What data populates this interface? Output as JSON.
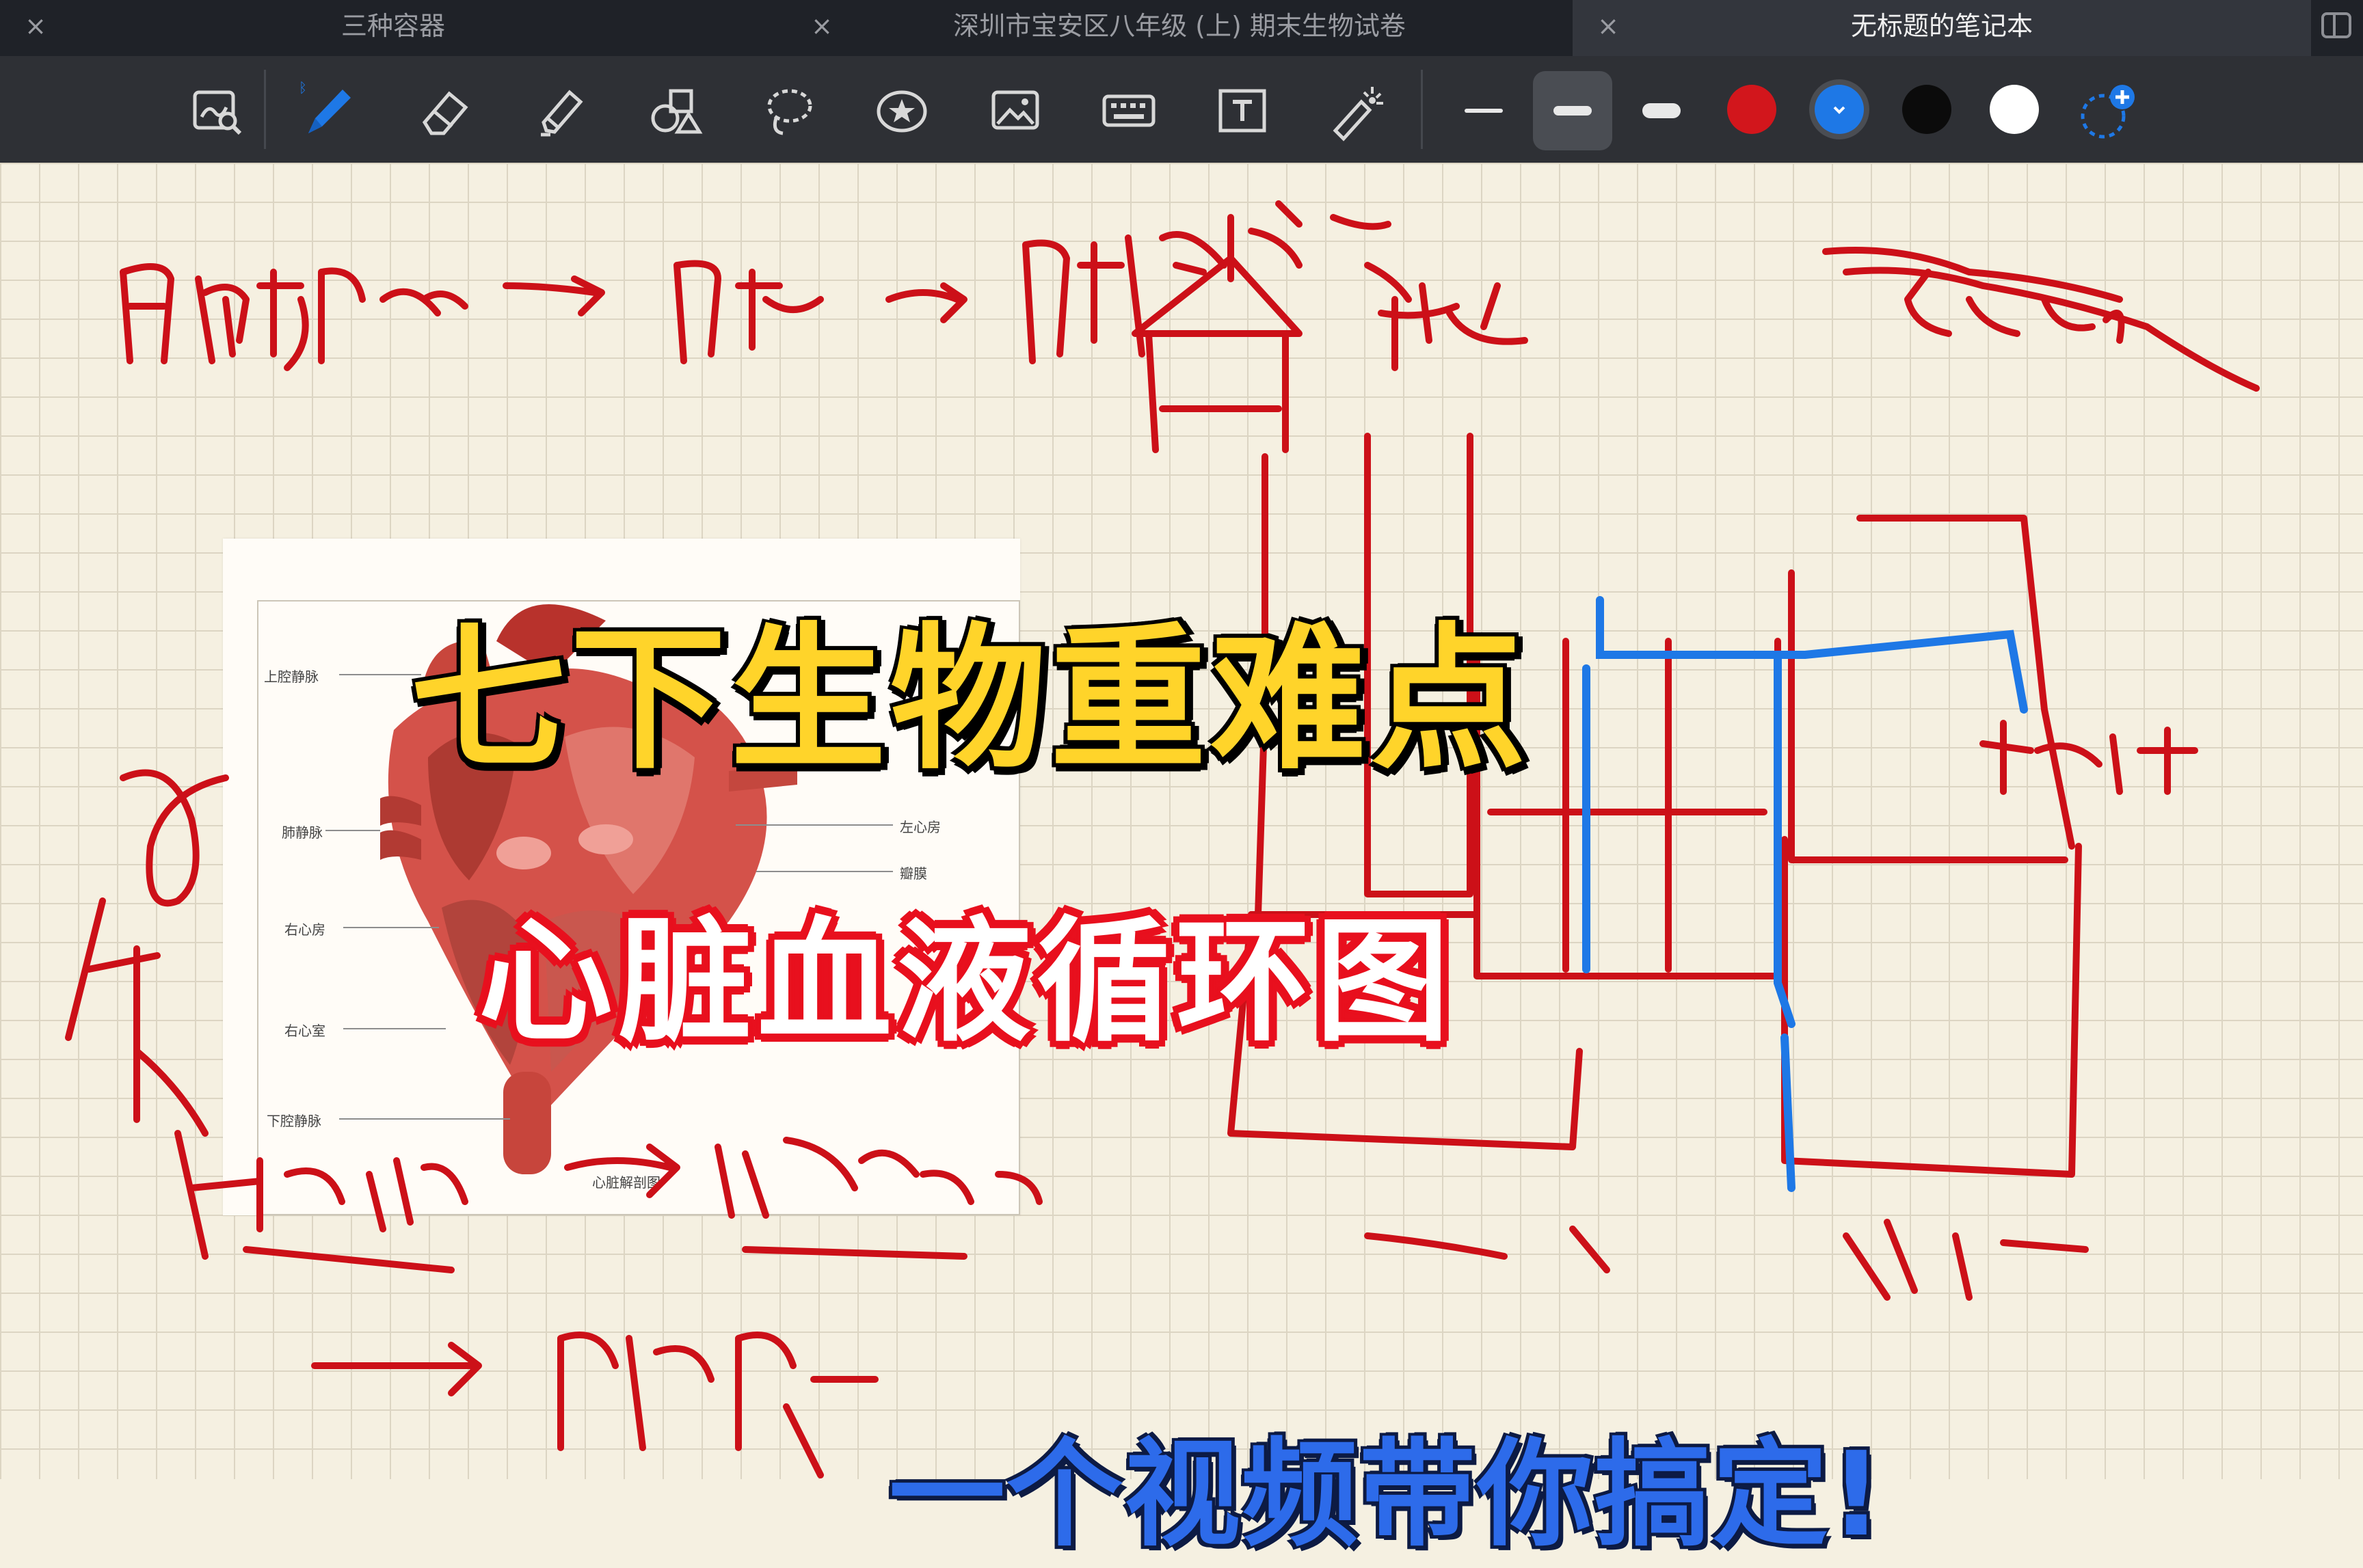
{
  "tabs": [
    {
      "title": "三种容器",
      "close": "×",
      "active": false
    },
    {
      "title": "深圳市宝安区八年级 (上) 期末生物试卷",
      "close": "×",
      "active": false
    },
    {
      "title": "无标题的笔记本",
      "close": "×",
      "active": true
    }
  ],
  "toolbar": {
    "tools": [
      "zoom-selection-icon",
      "pen-icon",
      "eraser-icon",
      "highlighter-icon",
      "shapes-icon",
      "lasso-icon",
      "sticker-star-icon",
      "image-icon",
      "keyboard-icon",
      "text-box-icon",
      "laser-pointer-icon"
    ],
    "active_tool": "pen-icon",
    "stroke_widths": [
      "thin",
      "medium",
      "thick"
    ],
    "selected_stroke": "medium",
    "colors": [
      "#d2161c",
      "#1e78e6",
      "#0b0b0b",
      "#ffffff"
    ],
    "selected_color": "#1e78e6",
    "add_color_icon": "add-color-icon"
  },
  "diagram": {
    "caption": "心脏解剖图",
    "labels": {
      "upper": "上腔静脉",
      "pulmonary_vein": "肺静脉",
      "right_atrium": "右心房",
      "right_ventricle": "右心室",
      "lower": "下腔静脉",
      "left_atrium": "左心房",
      "valve": "瓣膜"
    }
  },
  "overlay": {
    "title_main": "七下生物重难点",
    "title_sub": "心脏血液循环图",
    "title_bottom": "一个视频带你搞定!"
  },
  "colors": {
    "ink_red": "#cc1018",
    "ink_blue": "#1e78e6",
    "title_yellow": "#ffd42a",
    "title_blue": "#2d6bea",
    "tab_bar": "#1f2228",
    "toolbar": "#2e3035",
    "paper": "#f5f0e1"
  }
}
